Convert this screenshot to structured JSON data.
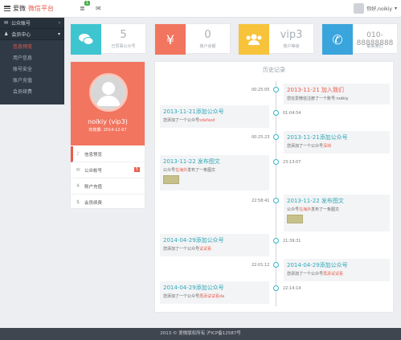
{
  "header": {
    "brand_main": "爱微",
    "brand_accent": "微信平台",
    "notif_count": "1",
    "user_name": "你好,noikiy"
  },
  "sidebar": {
    "group1": "公众账号",
    "group2": "会员中心",
    "items": [
      "信息预览",
      "用户信息",
      "账号安全",
      "账户充值",
      "会员续费"
    ]
  },
  "stats": [
    {
      "icon": "chat-icon",
      "value": "5",
      "label": "已同事公众号",
      "color": "#3fc5d0"
    },
    {
      "icon": "yen-icon",
      "value": "0",
      "label": "账户余额",
      "color": "#f2755f"
    },
    {
      "icon": "users-icon",
      "value": "vip3",
      "label": "账户等级",
      "color": "#f6c33b"
    },
    {
      "icon": "phone-icon",
      "value": "010-88888888",
      "label": "联系我们",
      "color": "#3aa4dc"
    }
  ],
  "profile": {
    "name": "noikiy (vip3)",
    "date": "有效期: 2014-12-07",
    "menu": [
      {
        "icon": "bell-icon",
        "label": "信息预览",
        "count": ""
      },
      {
        "icon": "comment-icon",
        "label": "公众帐号",
        "count": "5"
      },
      {
        "icon": "yen-icon",
        "label": "账户充值",
        "count": ""
      },
      {
        "icon": "dollar-icon",
        "label": "会员续费",
        "count": ""
      }
    ]
  },
  "timeline": {
    "title": "历史记录",
    "events": [
      {
        "time": "00:25:05",
        "title": "2013-11-21 加入我们",
        "body_pre": "您在爱微信注册了一个账号:noikiy",
        "highlight": "",
        "body_post": "",
        "side": "right",
        "red": true,
        "thumb": false
      },
      {
        "time": "01:04:54",
        "title": "2013-11-21添加公众号",
        "body_pre": "您添加了一个公众号",
        "highlight": "sdafasd",
        "body_post": "",
        "side": "left",
        "red": false,
        "thumb": false
      },
      {
        "time": "00:25:23",
        "title": "2013-11-21添加公众号",
        "body_pre": "您添加了一个公众号",
        "highlight": "深圳",
        "body_post": "",
        "side": "right",
        "red": false,
        "thumb": false
      },
      {
        "time": "23:13:07",
        "title": "2013-11-22 发布图文",
        "body_pre": "公众号",
        "highlight": "在海外",
        "body_post": "发布了一条图文",
        "side": "left",
        "red": false,
        "thumb": true
      },
      {
        "time": "22:58:41",
        "title": "2013-11-22 发布图文",
        "body_pre": "公众号",
        "highlight": "在海外",
        "body_post": "发布了一条图文",
        "side": "right",
        "red": false,
        "thumb": true
      },
      {
        "time": "21:39:31",
        "title": "2014-04-29添加公众号",
        "body_pre": "您添加了一个公众号",
        "highlight": "试试看",
        "body_post": "",
        "side": "left",
        "red": false,
        "thumb": false
      },
      {
        "time": "22:01:12",
        "title": "2014-04-29添加公众号",
        "body_pre": "您添加了一个公众号",
        "highlight": "再添试试看",
        "body_post": "",
        "side": "right",
        "red": false,
        "thumb": false
      },
      {
        "time": "22:14:14",
        "title": "2014-04-29添加公众号",
        "body_pre": "您添加了一个公众号",
        "highlight": "再添试试看da",
        "body_post": "",
        "side": "left",
        "red": false,
        "thumb": false
      }
    ]
  },
  "footer": {
    "text": "2013 © 爱微版权所有 沪ICP备12587号"
  }
}
